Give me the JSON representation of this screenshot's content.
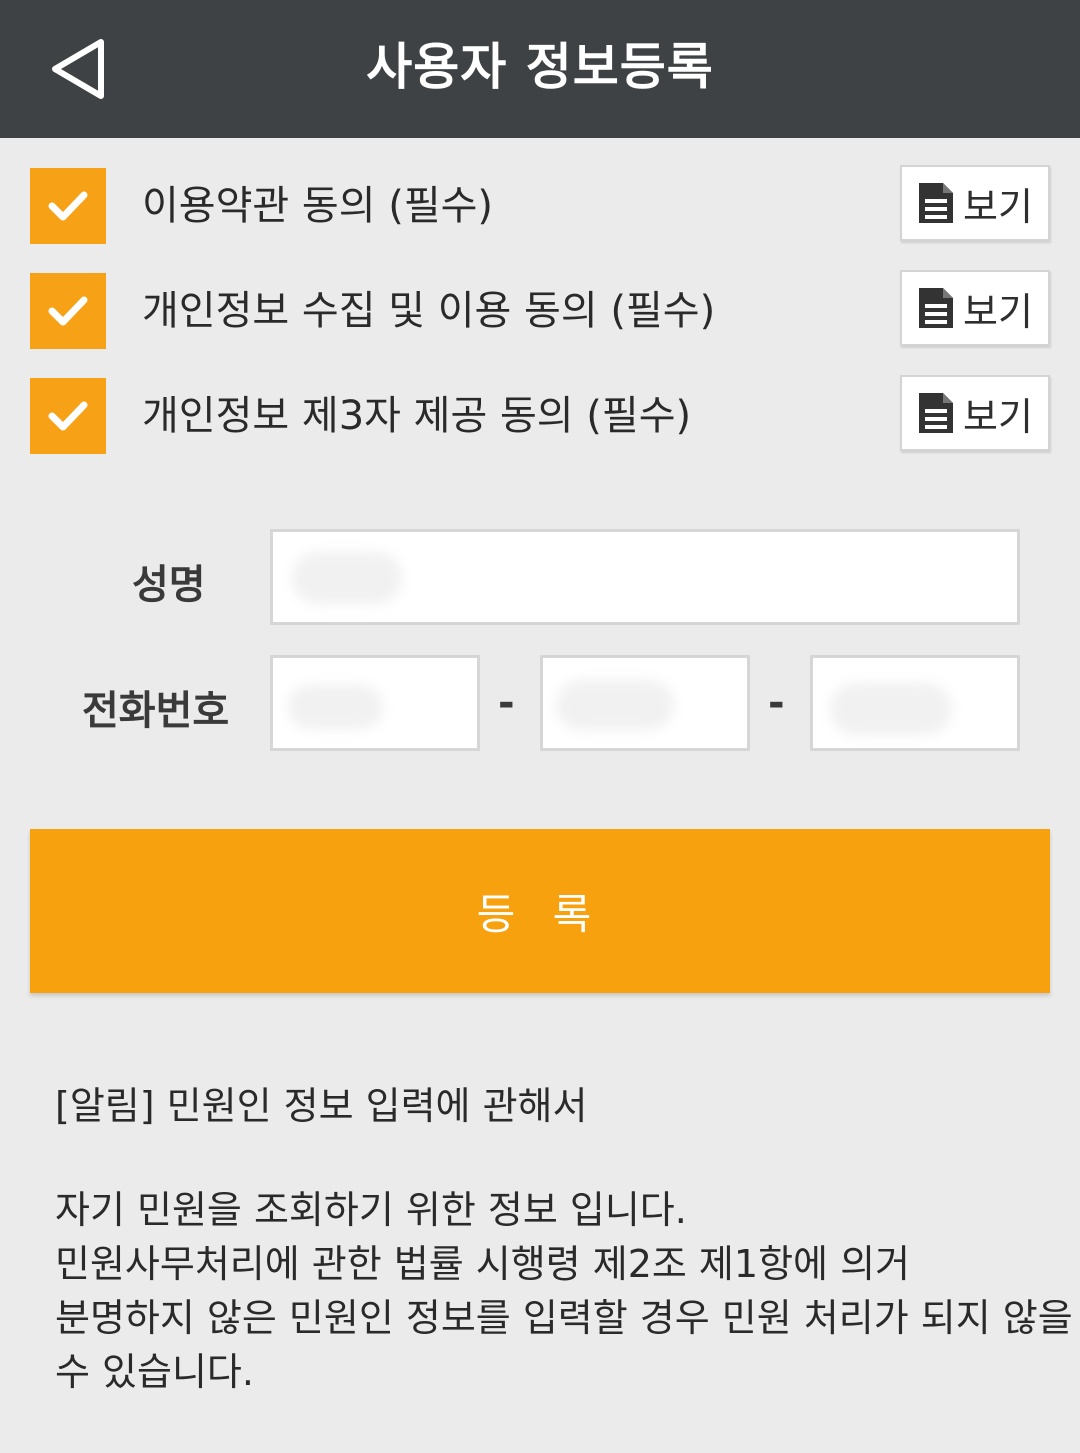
{
  "header": {
    "title": "사용자 정보등록"
  },
  "agreements": [
    {
      "label": "이용약관 동의 (필수)",
      "checked": true,
      "view_label": "보기"
    },
    {
      "label": "개인정보 수집 및 이용 동의 (필수)",
      "checked": true,
      "view_label": "보기"
    },
    {
      "label": "개인정보 제3자 제공 동의 (필수)",
      "checked": true,
      "view_label": "보기"
    }
  ],
  "form": {
    "name_label": "성명",
    "phone_label": "전화번호",
    "phone_separator": "-"
  },
  "register_button": "등 록",
  "notice": {
    "title": "[알림] 민원인 정보 입력에 관해서",
    "lines": [
      "자기 민원을 조회하기 위한 정보 입니다.",
      "민원사무처리에 관한 법률 시행령 제2조 제1항에 의거",
      "분명하지 않은 민원인 정보를 입력할 경우 민원 처리가 되지 않을",
      "수 있습니다."
    ]
  },
  "colors": {
    "accent": "#f7a116",
    "header_bg": "#3f4245",
    "page_bg": "#ebebeb"
  },
  "icons": {
    "back": "back-triangle-icon",
    "check": "check-icon",
    "document": "document-icon"
  }
}
